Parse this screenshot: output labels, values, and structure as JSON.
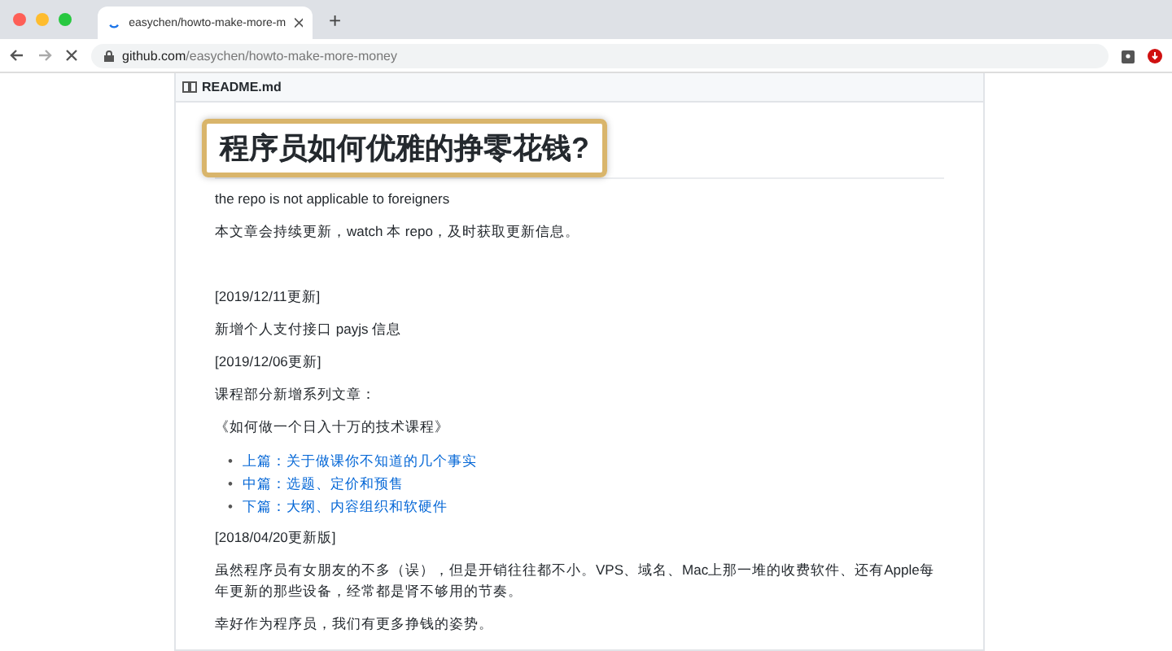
{
  "browser": {
    "tab": {
      "title": "easychen/howto-make-more-m",
      "loading": true
    },
    "new_tab": "+",
    "address": {
      "host": "github.com",
      "path": "/easychen/howto-make-more-money"
    }
  },
  "readme": {
    "filename": "README.md",
    "title": "程序员如何优雅的挣零花钱?",
    "title_highlighted": true,
    "blocks": [
      {
        "kind": "para",
        "text": "the repo is not applicable to foreigners"
      },
      {
        "kind": "para",
        "text": "本文章会持续更新，watch 本 repo，及时获取更新信息。"
      },
      {
        "kind": "gap"
      },
      {
        "kind": "para",
        "text": "[2019/12/11更新]"
      },
      {
        "kind": "para",
        "text": "新增个人支付接口 payjs 信息"
      },
      {
        "kind": "para",
        "text": "[2019/12/06更新]"
      },
      {
        "kind": "para",
        "text": "课程部分新增系列文章："
      },
      {
        "kind": "para",
        "text": "《如何做一个日入十万的技术课程》"
      },
      {
        "kind": "links",
        "bullet": "•",
        "items": [
          "上篇：关于做课你不知道的几个事实",
          "中篇：选题、定价和预售",
          "下篇：大纲、内容组织和软硬件"
        ]
      },
      {
        "kind": "para",
        "text": "[2018/04/20更新版]"
      },
      {
        "kind": "para",
        "text": "虽然程序员有女朋友的不多（误），但是开销往往都不小。VPS、域名、Mac上那一堆的收费软件、还有Apple每年更新的那些设备，经常都是肾不够用的节奏。"
      },
      {
        "kind": "para",
        "text": "幸好作为程序员，我们有更多挣钱的姿势。"
      }
    ]
  }
}
